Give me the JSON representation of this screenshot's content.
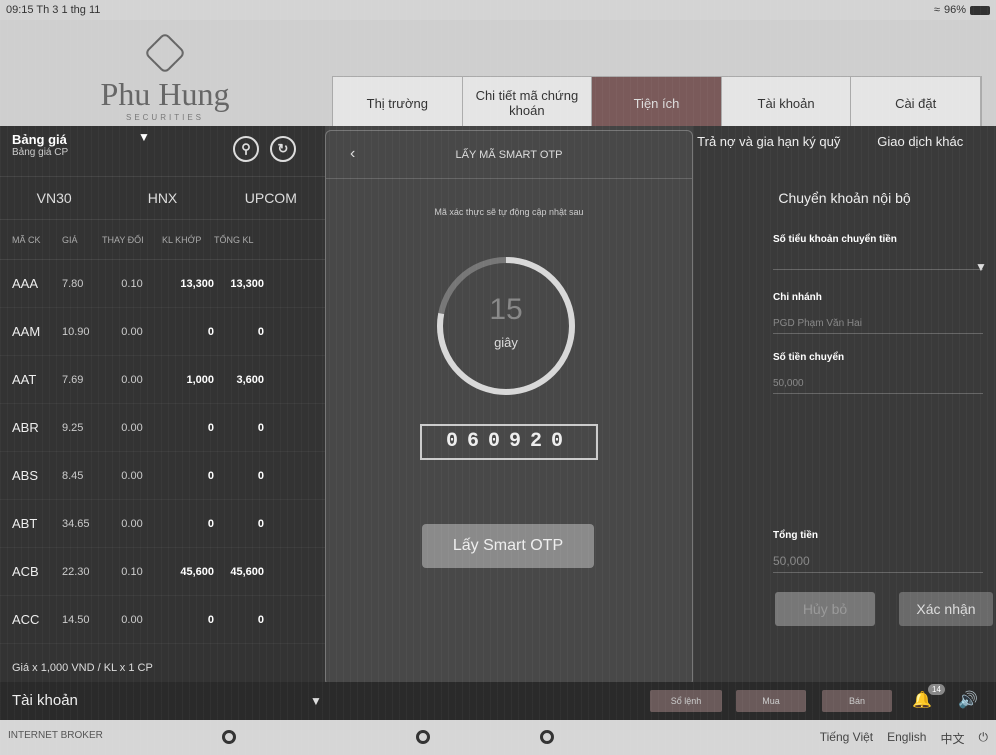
{
  "status_bar": {
    "time": "09:15  Th 3 1 thg 11",
    "battery": "96%"
  },
  "logo": {
    "name": "Phu Hung",
    "sub": "SECURITIES"
  },
  "top_nav": [
    {
      "label": "Thị trường",
      "active": false
    },
    {
      "label": "Chi tiết mã chứng khoán",
      "active": false
    },
    {
      "label": "Tiện ích",
      "active": true
    },
    {
      "label": "Tài khoản",
      "active": false
    },
    {
      "label": "Cài đặt",
      "active": false
    }
  ],
  "left_panel": {
    "title": "Bảng giá",
    "subtitle": "Bảng giá CP",
    "market_tabs": [
      "VN30",
      "HNX",
      "UPCOM"
    ],
    "columns": [
      "MÃ CK",
      "GIÁ",
      "THAY ĐỔI",
      "KL KHỚP",
      "TỔNG KL"
    ],
    "rows": [
      {
        "symbol": "AAA",
        "price": "7.80",
        "change": "0.10",
        "matched": "13,300",
        "total": "13,300"
      },
      {
        "symbol": "AAM",
        "price": "10.90",
        "change": "0.00",
        "matched": "0",
        "total": "0"
      },
      {
        "symbol": "AAT",
        "price": "7.69",
        "change": "0.00",
        "matched": "1,000",
        "total": "3,600"
      },
      {
        "symbol": "ABR",
        "price": "9.25",
        "change": "0.00",
        "matched": "0",
        "total": "0"
      },
      {
        "symbol": "ABS",
        "price": "8.45",
        "change": "0.00",
        "matched": "0",
        "total": "0"
      },
      {
        "symbol": "ABT",
        "price": "34.65",
        "change": "0.00",
        "matched": "0",
        "total": "0"
      },
      {
        "symbol": "ACB",
        "price": "22.30",
        "change": "0.10",
        "matched": "45,600",
        "total": "45,600"
      },
      {
        "symbol": "ACC",
        "price": "14.50",
        "change": "0.00",
        "matched": "0",
        "total": "0"
      }
    ],
    "footer": "Giá x 1,000 VND / KL x 1 CP"
  },
  "right_panel": {
    "tabs": [
      "Trả nợ và gia hạn ký quỹ",
      "Giao dịch khác"
    ],
    "title": "Chuyển khoản nội bộ",
    "fields": [
      {
        "label": "Số tiểu khoản chuyển tiền",
        "value": ""
      },
      {
        "label": "Chi nhánh",
        "value": "PGD Phạm Văn Hai"
      },
      {
        "label": "Số tiền chuyển",
        "value": "50,000"
      },
      {
        "label": "Tổng tiền",
        "value": "50,000"
      }
    ],
    "cancel_label": "Hủy bỏ",
    "confirm_label": "Xác nhận"
  },
  "modal": {
    "title": "LẤY MÃ SMART OTP",
    "note": "Mã xác thực sẽ tự động cập nhật sau",
    "countdown": "15",
    "countdown_unit": "giây",
    "progress_fraction": 0.78,
    "otp_code": "060920",
    "button_label": "Lấy Smart OTP"
  },
  "bottom_bar": {
    "account_label": "Tài khoản",
    "buttons": [
      "Sổ lệnh",
      "Mua",
      "Bán"
    ],
    "notif_count": "14"
  },
  "footer": {
    "app_name": "INTERNET BROKER",
    "languages": [
      "Tiếng Việt",
      "English",
      "中文"
    ]
  }
}
